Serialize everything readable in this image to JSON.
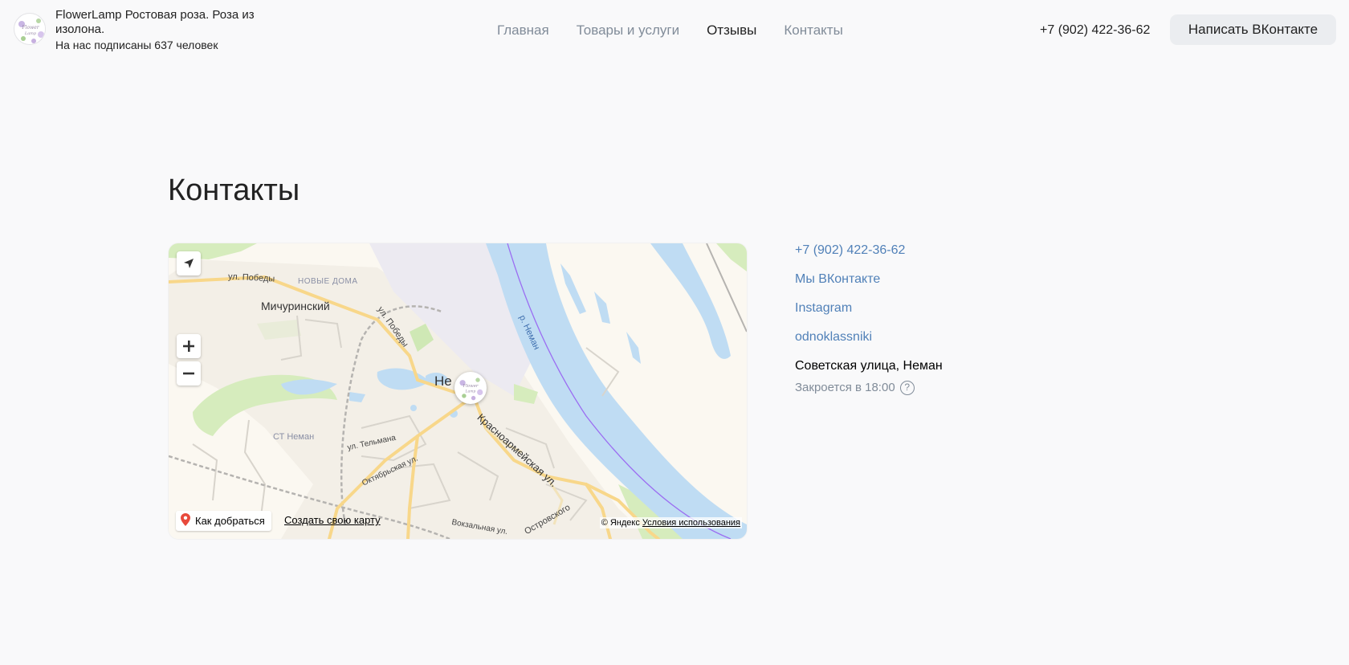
{
  "header": {
    "brand_name": "FlowerLamp Ростовая роза. Роза из изолона.",
    "subscribers": "На нас подписаны 637 человек",
    "phone": "+7 (902) 422-36-62",
    "write_button": "Написать ВКонтакте"
  },
  "nav": {
    "items": [
      {
        "label": "Главная",
        "active": false
      },
      {
        "label": "Товары и услуги",
        "active": false
      },
      {
        "label": "Отзывы",
        "active": true
      },
      {
        "label": "Контакты",
        "active": false
      }
    ]
  },
  "main": {
    "title": "Контакты"
  },
  "map": {
    "route_label": "Как добраться",
    "create_label": "Создать свою карту",
    "copyright": "© Яндекс",
    "terms": "Условия использования",
    "labels": {
      "street_pobedy": "ул. Победы",
      "street_pobedy_2": "ул. Победы",
      "district_new": "НОВЫЕ ДОМА",
      "michurinsky": "Мичуринский",
      "city": "Не",
      "st_neman": "СТ Неман",
      "telmana": "ул. Тельмана",
      "oktyabrskaya": "Октябрьская ул.",
      "krasnoarmeyskaya": "Красноармейская ул.",
      "vokzalnaya": "Вокзальная ул.",
      "ostrovskogo": "Островского",
      "river": "р. Неман"
    },
    "colors": {
      "water": "#bfdcf3",
      "river_line": "#9b6df2",
      "road": "#f8d78a",
      "park": "#d6ecbd"
    }
  },
  "contacts": {
    "phone": "+7 (902) 422-36-62",
    "vk": "Мы ВКонтакте",
    "instagram": "Instagram",
    "ok": "odnoklassniki",
    "address": "Советская улица, Неман",
    "hours": "Закроется в 18:00",
    "help_icon": "?"
  },
  "icons": {
    "locate": "arrow-navigate-icon",
    "zoom_in": "plus-icon",
    "zoom_out": "minus-icon",
    "route_pin": "map-pin-icon",
    "help": "question-circle-icon"
  }
}
